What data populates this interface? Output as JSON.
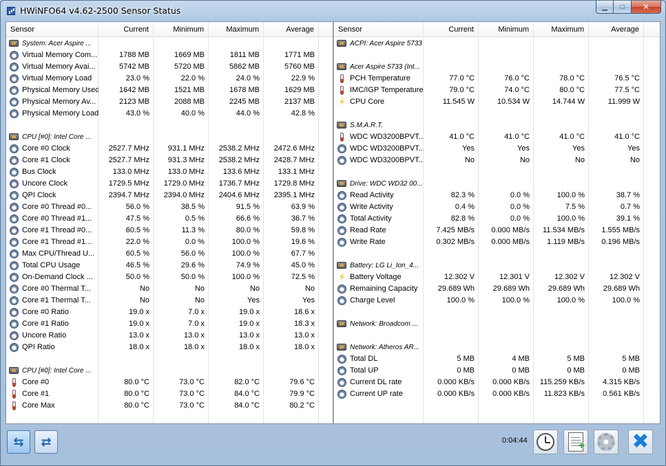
{
  "window": {
    "title": "HWiNFO64 v4.62-2500 Sensor Status",
    "min_glyph": "▁",
    "max_glyph": "□",
    "close_glyph": "✕"
  },
  "columns": {
    "sensor": "Sensor",
    "current": "Current",
    "minimum": "Minimum",
    "maximum": "Maximum",
    "average": "Average"
  },
  "left_rows": [
    {
      "type": "group",
      "icon": "chip-icon",
      "name": "System: Acer Aspire ..."
    },
    {
      "type": "sensor",
      "icon": "gauge-icon",
      "name": "Virtual Memory Com...",
      "current": "1788 MB",
      "minimum": "1669 MB",
      "maximum": "1811 MB",
      "average": "1771 MB"
    },
    {
      "type": "sensor",
      "icon": "gauge-icon",
      "name": "Virtual Memory Avai...",
      "current": "5742 MB",
      "minimum": "5720 MB",
      "maximum": "5862 MB",
      "average": "5760 MB"
    },
    {
      "type": "sensor",
      "icon": "gauge-icon",
      "name": "Virtual Memory Load",
      "current": "23.0 %",
      "minimum": "22.0 %",
      "maximum": "24.0 %",
      "average": "22.9 %"
    },
    {
      "type": "sensor",
      "icon": "gauge-icon",
      "name": "Physical Memory Used",
      "current": "1642 MB",
      "minimum": "1521 MB",
      "maximum": "1678 MB",
      "average": "1629 MB"
    },
    {
      "type": "sensor",
      "icon": "gauge-icon",
      "name": "Physical Memory Av...",
      "current": "2123 MB",
      "minimum": "2088 MB",
      "maximum": "2245 MB",
      "average": "2137 MB"
    },
    {
      "type": "sensor",
      "icon": "gauge-icon",
      "name": "Physical Memory Load",
      "current": "43.0 %",
      "minimum": "40.0 %",
      "maximum": "44.0 %",
      "average": "42.8 %"
    },
    {
      "type": "blank"
    },
    {
      "type": "group",
      "icon": "chip-icon",
      "name": "CPU [#0]: Intel Core ..."
    },
    {
      "type": "sensor",
      "icon": "gauge-icon",
      "name": "Core #0 Clock",
      "current": "2527.7 MHz",
      "minimum": "931.1 MHz",
      "maximum": "2538.2 MHz",
      "average": "2472.6 MHz"
    },
    {
      "type": "sensor",
      "icon": "gauge-icon",
      "name": "Core #1 Clock",
      "current": "2527.7 MHz",
      "minimum": "931.3 MHz",
      "maximum": "2538.2 MHz",
      "average": "2428.7 MHz"
    },
    {
      "type": "sensor",
      "icon": "gauge-icon",
      "name": "Bus Clock",
      "current": "133.0 MHz",
      "minimum": "133.0 MHz",
      "maximum": "133.6 MHz",
      "average": "133.1 MHz"
    },
    {
      "type": "sensor",
      "icon": "gauge-icon",
      "name": "Uncore Clock",
      "current": "1729.5 MHz",
      "minimum": "1729.0 MHz",
      "maximum": "1736.7 MHz",
      "average": "1729.8 MHz"
    },
    {
      "type": "sensor",
      "icon": "gauge-icon",
      "name": "QPI Clock",
      "current": "2394.7 MHz",
      "minimum": "2394.0 MHz",
      "maximum": "2404.6 MHz",
      "average": "2395.1 MHz"
    },
    {
      "type": "sensor",
      "icon": "gauge-icon",
      "name": "Core #0 Thread #0...",
      "current": "56.0 %",
      "minimum": "38.5 %",
      "maximum": "91.5 %",
      "average": "63.9 %"
    },
    {
      "type": "sensor",
      "icon": "gauge-icon",
      "name": "Core #0 Thread #1...",
      "current": "47.5 %",
      "minimum": "0.5 %",
      "maximum": "66.6 %",
      "average": "36.7 %"
    },
    {
      "type": "sensor",
      "icon": "gauge-icon",
      "name": "Core #1 Thread #0...",
      "current": "60.5 %",
      "minimum": "11.3 %",
      "maximum": "80.0 %",
      "average": "59.8 %"
    },
    {
      "type": "sensor",
      "icon": "gauge-icon",
      "name": "Core #1 Thread #1...",
      "current": "22.0 %",
      "minimum": "0.0 %",
      "maximum": "100.0 %",
      "average": "19.6 %"
    },
    {
      "type": "sensor",
      "icon": "gauge-icon",
      "name": "Max CPU/Thread U...",
      "current": "60.5 %",
      "minimum": "56.0 %",
      "maximum": "100.0 %",
      "average": "67.7 %"
    },
    {
      "type": "sensor",
      "icon": "gauge-icon",
      "name": "Total CPU Usage",
      "current": "46.5 %",
      "minimum": "29.6 %",
      "maximum": "74.9 %",
      "average": "45.0 %"
    },
    {
      "type": "sensor",
      "icon": "gauge-icon",
      "name": "On-Demand Clock ...",
      "current": "50.0 %",
      "minimum": "50.0 %",
      "maximum": "100.0 %",
      "average": "72.5 %"
    },
    {
      "type": "sensor",
      "icon": "gauge-icon",
      "name": "Core #0 Thermal T...",
      "current": "No",
      "minimum": "No",
      "maximum": "No",
      "average": "No"
    },
    {
      "type": "sensor",
      "icon": "gauge-icon",
      "name": "Core #1 Thermal T...",
      "current": "No",
      "minimum": "No",
      "maximum": "Yes",
      "average": "Yes"
    },
    {
      "type": "sensor",
      "icon": "gauge-icon",
      "name": "Core #0 Ratio",
      "current": "19.0 x",
      "minimum": "7.0 x",
      "maximum": "19.0 x",
      "average": "18.6 x"
    },
    {
      "type": "sensor",
      "icon": "gauge-icon",
      "name": "Core #1 Ratio",
      "current": "19.0 x",
      "minimum": "7.0 x",
      "maximum": "19.0 x",
      "average": "18.3 x"
    },
    {
      "type": "sensor",
      "icon": "gauge-icon",
      "name": "Uncore Ratio",
      "current": "13.0 x",
      "minimum": "13.0 x",
      "maximum": "13.0 x",
      "average": "13.0 x"
    },
    {
      "type": "sensor",
      "icon": "gauge-icon",
      "name": "QPI Ratio",
      "current": "18.0 x",
      "minimum": "18.0 x",
      "maximum": "18.0 x",
      "average": "18.0 x"
    },
    {
      "type": "blank"
    },
    {
      "type": "group",
      "icon": "chip-icon",
      "name": "CPU [#0]: Intel Core ..."
    },
    {
      "type": "sensor",
      "icon": "thermometer-icon",
      "name": "Core #0",
      "current": "80.0 °C",
      "minimum": "73.0 °C",
      "maximum": "82.0 °C",
      "average": "79.6 °C"
    },
    {
      "type": "sensor",
      "icon": "thermometer-icon",
      "name": "Core #1",
      "current": "80.0 °C",
      "minimum": "73.0 °C",
      "maximum": "84.0 °C",
      "average": "79.9 °C"
    },
    {
      "type": "sensor",
      "icon": "thermometer-icon",
      "name": "Core Max",
      "current": "80.0 °C",
      "minimum": "73.0 °C",
      "maximum": "84.0 °C",
      "average": "80.2 °C"
    }
  ],
  "right_rows": [
    {
      "type": "group",
      "icon": "chip-icon",
      "name": "ACPI: Acer Aspire 5733"
    },
    {
      "type": "blank"
    },
    {
      "type": "group",
      "icon": "chip-icon",
      "name": "Acer Aspire 5733 (Int..."
    },
    {
      "type": "sensor",
      "icon": "thermometer-icon",
      "name": "PCH Temperature",
      "current": "77.0 °C",
      "minimum": "76.0 °C",
      "maximum": "78.0 °C",
      "average": "76.5 °C"
    },
    {
      "type": "sensor",
      "icon": "thermometer-icon",
      "name": "IMC/IGP Temperature",
      "current": "79.0 °C",
      "minimum": "74.0 °C",
      "maximum": "80.0 °C",
      "average": "77.5 °C"
    },
    {
      "type": "sensor",
      "icon": "bolt-icon",
      "name": "CPU Core",
      "current": "11.545 W",
      "minimum": "10.534 W",
      "maximum": "14.744 W",
      "average": "11.999 W"
    },
    {
      "type": "blank"
    },
    {
      "type": "group",
      "icon": "chip-icon",
      "name": "S.M.A.R.T."
    },
    {
      "type": "sensor",
      "icon": "thermometer-icon",
      "name": "WDC WD3200BPVT...",
      "current": "41.0 °C",
      "minimum": "41.0 °C",
      "maximum": "41.0 °C",
      "average": "41.0 °C"
    },
    {
      "type": "sensor",
      "icon": "gauge-icon",
      "name": "WDC WD3200BPVT...",
      "current": "Yes",
      "minimum": "Yes",
      "maximum": "Yes",
      "average": "Yes"
    },
    {
      "type": "sensor",
      "icon": "gauge-icon",
      "name": "WDC WD3200BPVT...",
      "current": "No",
      "minimum": "No",
      "maximum": "No",
      "average": "No"
    },
    {
      "type": "blank"
    },
    {
      "type": "group",
      "icon": "chip-icon",
      "name": "Drive: WDC WD32 00..."
    },
    {
      "type": "sensor",
      "icon": "gauge-icon",
      "name": "Read Activity",
      "current": "82.3 %",
      "minimum": "0.0 %",
      "maximum": "100.0 %",
      "average": "38.7 %"
    },
    {
      "type": "sensor",
      "icon": "gauge-icon",
      "name": "Write Activity",
      "current": "0.4 %",
      "minimum": "0.0 %",
      "maximum": "7.5 %",
      "average": "0.7 %"
    },
    {
      "type": "sensor",
      "icon": "gauge-icon",
      "name": "Total Activity",
      "current": "82.8 %",
      "minimum": "0.0 %",
      "maximum": "100.0 %",
      "average": "39.1 %"
    },
    {
      "type": "sensor",
      "icon": "gauge-icon",
      "name": "Read Rate",
      "current": "7.425 MB/s",
      "minimum": "0.000 MB/s",
      "maximum": "11.534 MB/s",
      "average": "1.555 MB/s"
    },
    {
      "type": "sensor",
      "icon": "gauge-icon",
      "name": "Write Rate",
      "current": "0.302 MB/s",
      "minimum": "0.000 MB/s",
      "maximum": "1.119 MB/s",
      "average": "0.196 MB/s"
    },
    {
      "type": "blank"
    },
    {
      "type": "group",
      "icon": "chip-icon",
      "name": "Battery: LG  Li_Ion_4..."
    },
    {
      "type": "sensor",
      "icon": "bolt-icon",
      "name": "Battery Voltage",
      "current": "12.302 V",
      "minimum": "12.301 V",
      "maximum": "12.302 V",
      "average": "12.302 V"
    },
    {
      "type": "sensor",
      "icon": "gauge-icon",
      "name": "Remaining Capacity",
      "current": "29.689 Wh",
      "minimum": "29.689 Wh",
      "maximum": "29.689 Wh",
      "average": "29.689 Wh"
    },
    {
      "type": "sensor",
      "icon": "gauge-icon",
      "name": "Charge Level",
      "current": "100.0 %",
      "minimum": "100.0 %",
      "maximum": "100.0 %",
      "average": "100.0 %"
    },
    {
      "type": "blank"
    },
    {
      "type": "group",
      "icon": "chip-icon",
      "name": "Network: Broadcom ..."
    },
    {
      "type": "blank"
    },
    {
      "type": "group",
      "icon": "chip-icon",
      "name": "Network: Atheros AR..."
    },
    {
      "type": "sensor",
      "icon": "gauge-icon",
      "name": "Total DL",
      "current": "5 MB",
      "minimum": "4 MB",
      "maximum": "5 MB",
      "average": "5 MB"
    },
    {
      "type": "sensor",
      "icon": "gauge-icon",
      "name": "Total UP",
      "current": "0 MB",
      "minimum": "0 MB",
      "maximum": "0 MB",
      "average": "0 MB"
    },
    {
      "type": "sensor",
      "icon": "gauge-icon",
      "name": "Current DL rate",
      "current": "0.000 KB/s",
      "minimum": "0.000 KB/s",
      "maximum": "115.259 KB/s",
      "average": "4.315 KB/s"
    },
    {
      "type": "sensor",
      "icon": "gauge-icon",
      "name": "Current UP rate",
      "current": "0.000 KB/s",
      "minimum": "0.000 KB/s",
      "maximum": "11.823 KB/s",
      "average": "0.561 KB/s"
    }
  ],
  "bottom": {
    "elapsed": "0:04:44",
    "nav_left_glyph": "⇆",
    "nav_right_glyph": "⇄",
    "close_glyph": "✖"
  }
}
